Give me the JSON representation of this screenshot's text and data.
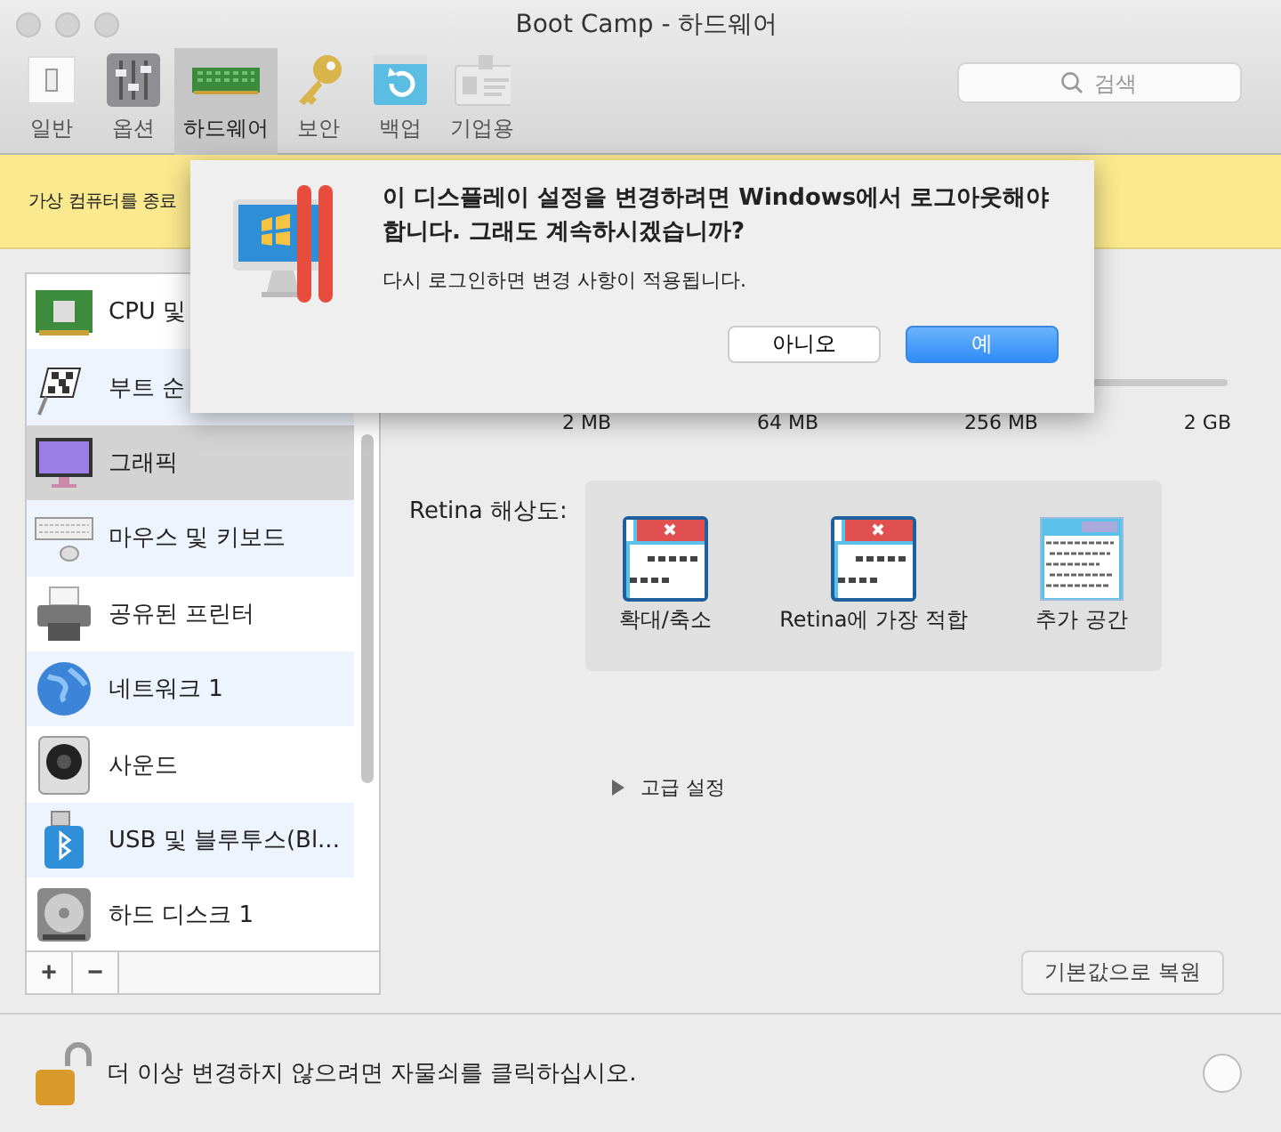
{
  "window": {
    "title": "Boot Camp - 하드웨어"
  },
  "toolbar": [
    {
      "label": "일반",
      "selected": false
    },
    {
      "label": "옵션",
      "selected": false
    },
    {
      "label": "하드웨어",
      "selected": true
    },
    {
      "label": "보안",
      "selected": false
    },
    {
      "label": "백업",
      "selected": false
    },
    {
      "label": "기업용",
      "selected": false
    }
  ],
  "search": {
    "placeholder": "검색"
  },
  "banner": {
    "text": "가상 컴퓨터를 종료"
  },
  "sidebar": {
    "items": [
      {
        "label": "CPU 및",
        "selected": false
      },
      {
        "label": "부트 순",
        "selected": false
      },
      {
        "label": "그래픽",
        "selected": true
      },
      {
        "label": "마우스 및 키보드",
        "selected": false
      },
      {
        "label": "공유된 프린터",
        "selected": false
      },
      {
        "label": "네트워크 1",
        "selected": false
      },
      {
        "label": "사운드",
        "selected": false
      },
      {
        "label": "USB 및 블루투스(Bl...",
        "selected": false
      },
      {
        "label": "하드 디스크 1",
        "selected": false
      }
    ],
    "add_label": "+",
    "remove_label": "−"
  },
  "memory_scale": [
    "2 MB",
    "64 MB",
    "256 MB",
    "2 GB"
  ],
  "retina": {
    "label": "Retina 해상도:",
    "options": [
      {
        "label": "확대/축소",
        "kind": "large"
      },
      {
        "label": "Retina에 가장 적합",
        "kind": "large"
      },
      {
        "label": "추가 공간",
        "kind": "small"
      }
    ]
  },
  "advanced": {
    "label": "고급 설정",
    "expanded": false
  },
  "restore_button": "기본값으로 복원",
  "lock": {
    "text": "더 이상 변경하지 않으려면 자물쇠를 클릭하십시오.",
    "locked": false
  },
  "dialog": {
    "message": "이 디스플레이 설정을 변경하려면 Windows에서 로그아웃해야 합니다. 그래도 계속하시겠습니까?",
    "detail": "다시 로그인하면 변경 사항이 적용됩니다.",
    "buttons": [
      {
        "label": "아니오",
        "default": false
      },
      {
        "label": "예",
        "default": true
      }
    ]
  }
}
